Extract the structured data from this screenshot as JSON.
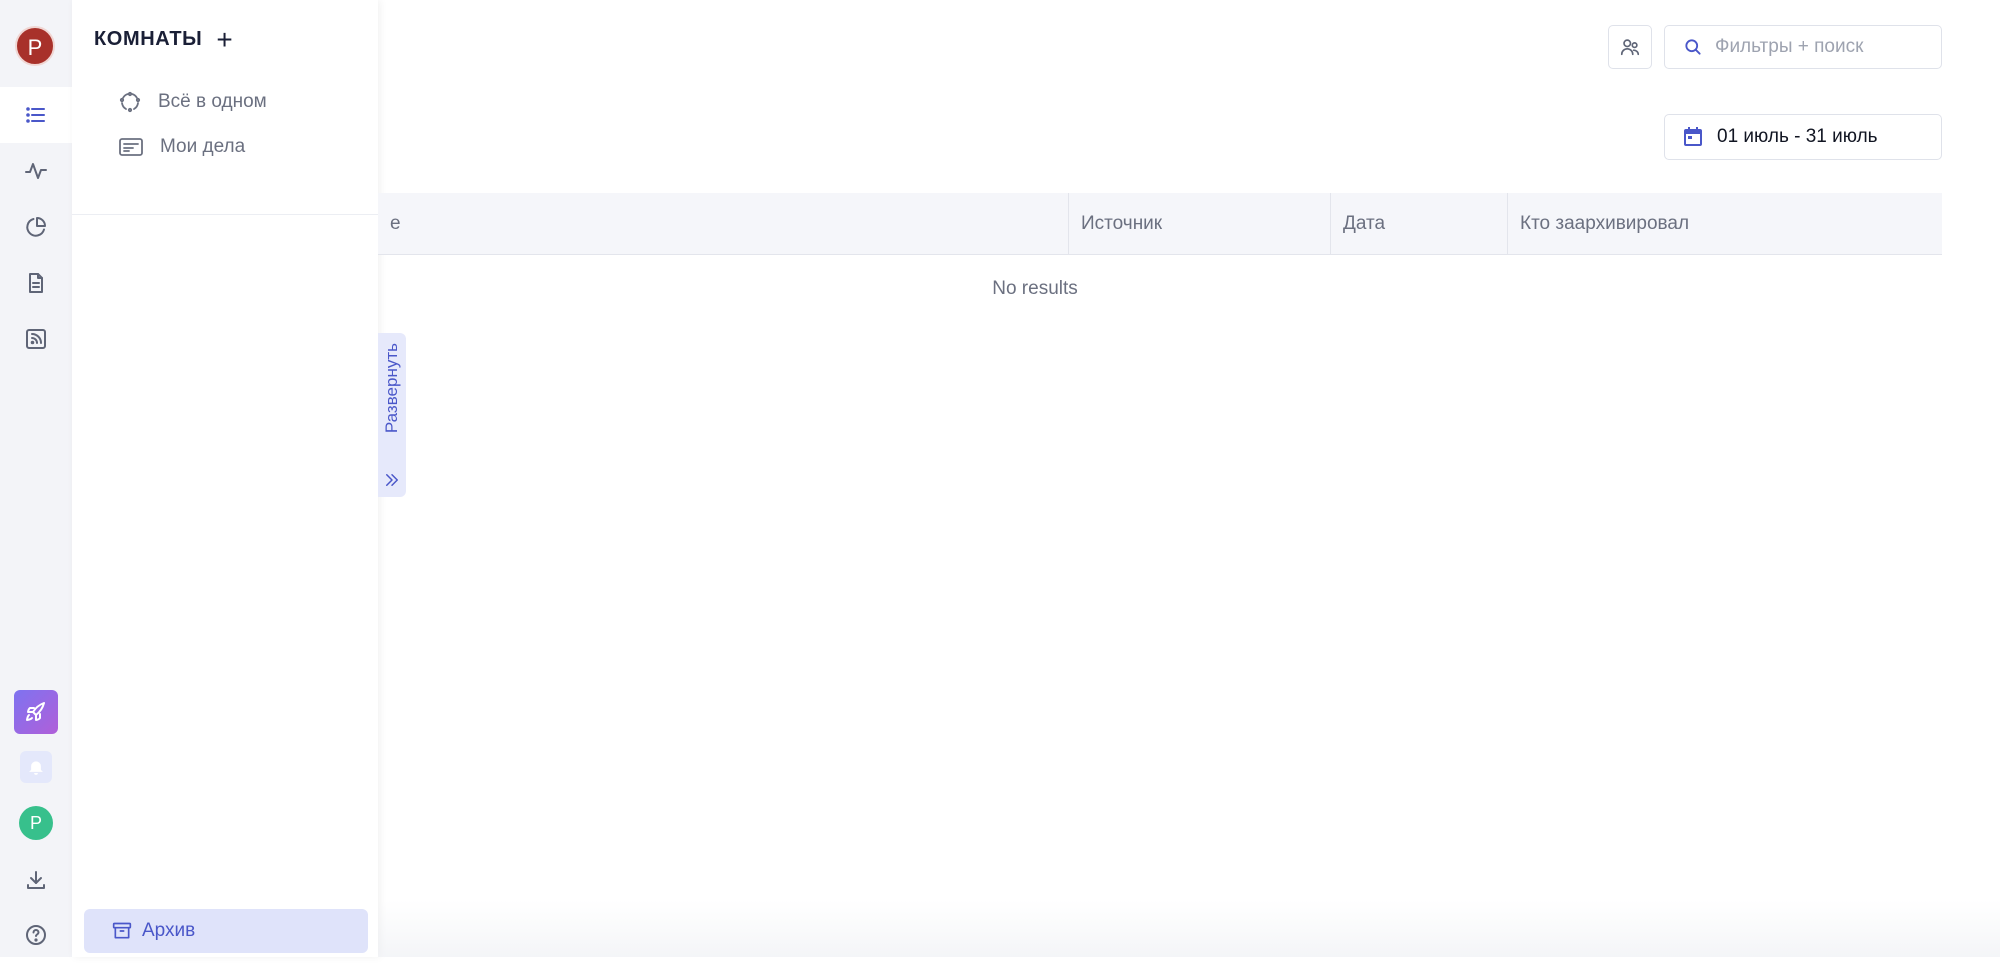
{
  "rail": {
    "avatar_letter": "P",
    "bottom_avatar_letter": "P"
  },
  "rooms": {
    "title": "КОМНАТЫ",
    "add_symbol": "+",
    "items": [
      {
        "label": "Всё в одном",
        "icon": "all-in-one-icon"
      },
      {
        "label": "Мои дела",
        "icon": "my-tasks-icon"
      }
    ],
    "archive_label": "Архив"
  },
  "expand_label": "Развернуть",
  "search": {
    "placeholder": "Фильтры + поиск"
  },
  "date_range": "01 июль - 31 июль",
  "table": {
    "columns": [
      "е",
      "Источник",
      "Дата",
      "Кто заархивировал"
    ],
    "empty_text": "No results"
  },
  "colors": {
    "accent": "#4a57c9",
    "avatar_red": "#a8312a",
    "avatar_green": "#37c08c"
  }
}
